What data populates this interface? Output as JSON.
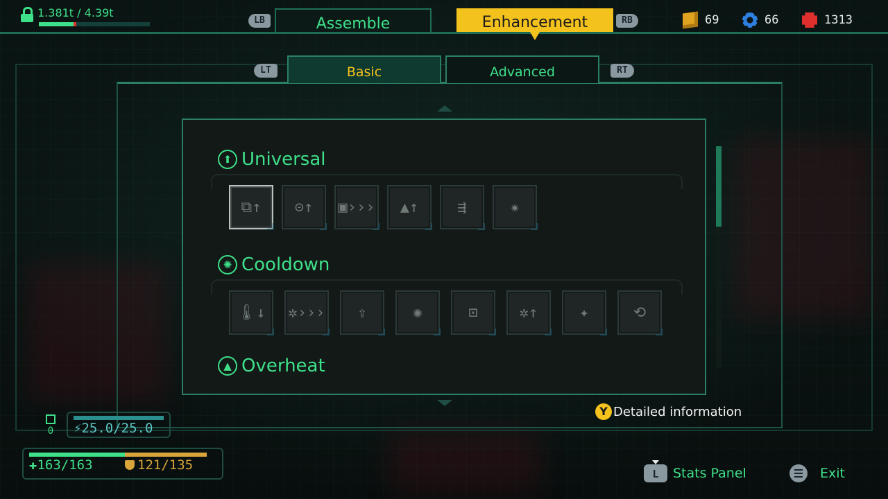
{
  "top": {
    "weight_text": "1.381t / 4.39t",
    "weight_fraction": 0.315,
    "lb": "LB",
    "rb": "RB",
    "tabs": [
      {
        "label": "Assemble",
        "active": false
      },
      {
        "label": "Enhancement",
        "active": true
      }
    ],
    "resources": [
      {
        "icon": "gold-cube-icon",
        "value": "69",
        "color": "#e0a31f"
      },
      {
        "icon": "blue-gear-icon",
        "value": "66",
        "color": "#2e7fe0"
      },
      {
        "icon": "red-chip-icon",
        "value": "1313",
        "color": "#e0302e"
      }
    ]
  },
  "subtabs": {
    "lt": "LT",
    "rt": "RT",
    "items": [
      {
        "label": "Basic",
        "active": true
      },
      {
        "label": "Advanced",
        "active": false
      }
    ]
  },
  "sections": [
    {
      "title": "Universal",
      "icon": "up-arrow-icon",
      "slots": [
        "⧉↑",
        "⊝↑",
        "▣›››",
        "▲↑",
        "⇶",
        "✷"
      ],
      "selected_index": 0
    },
    {
      "title": "Cooldown",
      "icon": "swirl-icon",
      "slots": [
        "🌡↓",
        "✲›››",
        "⇪",
        "✺",
        "⊡",
        "✲↑",
        "✦",
        "⟲"
      ],
      "selected_index": -1
    },
    {
      "title": "Overheat",
      "icon": "flame-icon",
      "slots": [],
      "selected_index": -1
    }
  ],
  "status": {
    "mini_label": "0",
    "energy": "25.0/25.0",
    "hp": "163/163",
    "shield": "121/135"
  },
  "prompts": {
    "detail": {
      "button": "Y",
      "label": "Detailed information"
    },
    "stats": {
      "button": "L",
      "label": "Stats Panel"
    },
    "exit": {
      "label": "Exit"
    }
  }
}
